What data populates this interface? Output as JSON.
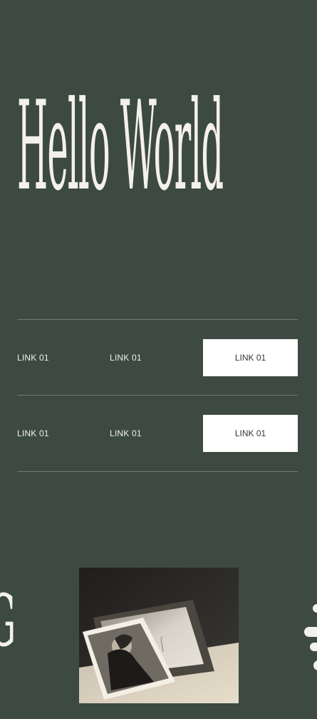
{
  "hero": {
    "title": "Hello World"
  },
  "links": {
    "rows": [
      {
        "link1": "LINK 01",
        "link2": "LINK 01",
        "button": "LINK 01"
      },
      {
        "link1": "LINK 01",
        "link2": "LINK 01",
        "button": "LINK 01"
      }
    ]
  },
  "gallery": {
    "left_letter": "G"
  },
  "colors": {
    "background": "#3c4a42",
    "text": "#f4f1ea",
    "button_bg": "#ffffff",
    "button_text": "#2f3833"
  }
}
